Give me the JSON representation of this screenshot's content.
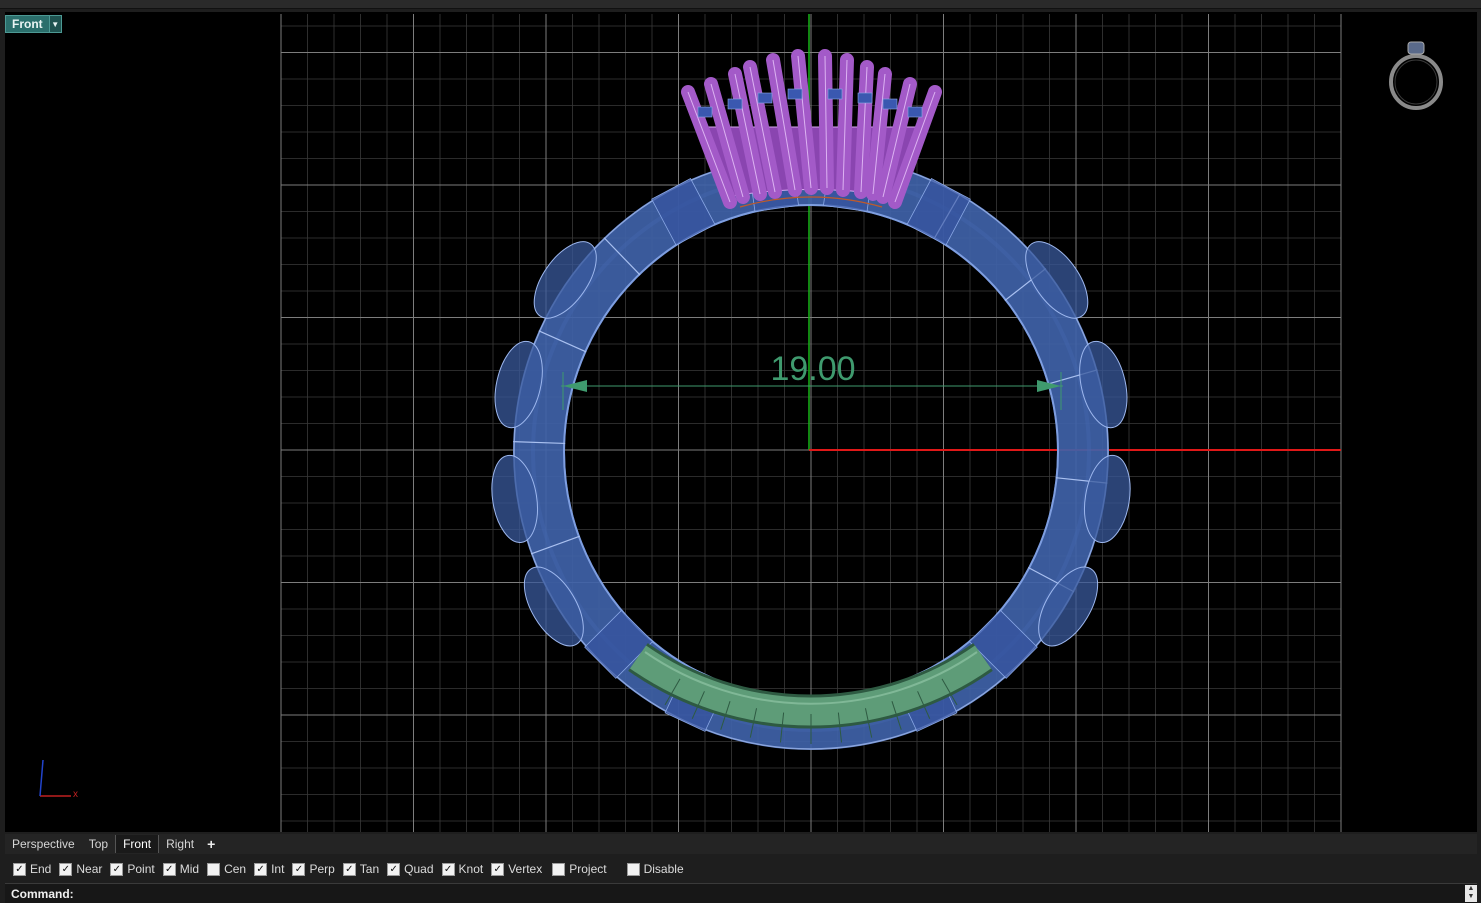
{
  "viewport": {
    "title": "Front",
    "dimension_label": "19.00"
  },
  "axes": {
    "x_label": "x"
  },
  "view_tabs": [
    "Perspective",
    "Top",
    "Front",
    "Right"
  ],
  "active_view_tab": "Front",
  "add_tab_symbol": "+",
  "osnaps": [
    {
      "label": "End",
      "checked": true
    },
    {
      "label": "Near",
      "checked": true
    },
    {
      "label": "Point",
      "checked": true
    },
    {
      "label": "Mid",
      "checked": true
    },
    {
      "label": "Cen",
      "checked": false
    },
    {
      "label": "Int",
      "checked": true
    },
    {
      "label": "Perp",
      "checked": true
    },
    {
      "label": "Tan",
      "checked": true
    },
    {
      "label": "Quad",
      "checked": true
    },
    {
      "label": "Knot",
      "checked": true
    },
    {
      "label": "Vertex",
      "checked": true
    },
    {
      "label": "Project",
      "checked": false
    },
    {
      "label": "Disable",
      "checked": false
    }
  ],
  "command": {
    "label": "Command:"
  },
  "colors": {
    "grid_major": "#7d7d7d",
    "grid_minor": "#3a3a3a",
    "x_axis": "#e01818",
    "y_axis": "#18b418",
    "ring_body": "#4a6fb5",
    "prongs": "#a35ac8",
    "shank": "#4e8a66",
    "dimension": "#3f9a6e",
    "viewport_title_bg": "#2b6f6c"
  }
}
